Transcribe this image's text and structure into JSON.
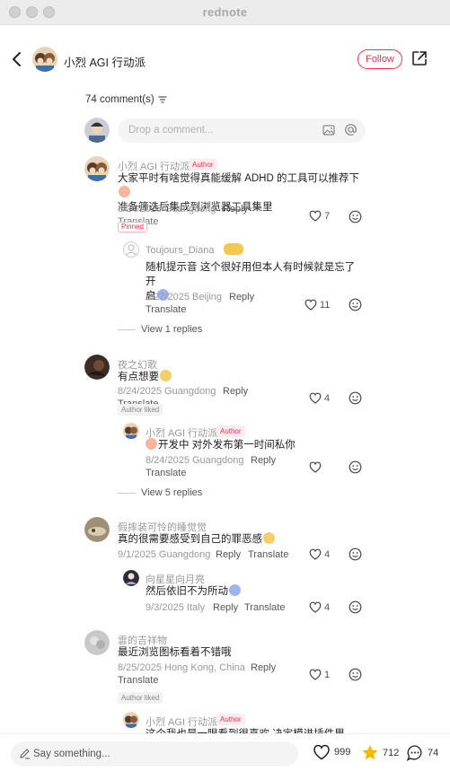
{
  "window": {
    "title": "rednote"
  },
  "header": {
    "author_name": "小烈 AGI 行动派",
    "follow_label": "Follow"
  },
  "comments_count": "74 comment(s)",
  "drop_placeholder": "Drop a comment...",
  "comments": [
    {
      "name": "小烈 AGI 行动派",
      "author_badge": "Author",
      "text_line1": "大家平时有啥觉得真能缓解 ADHD 的工具可以推荐下",
      "text_line2": "准备筛选后集成到浏览器工具集里",
      "date": "8/24/2025",
      "location": "Guangdong",
      "reply": "Reply",
      "translate": "Translate",
      "likes": "7",
      "pinned": "Pinned"
    },
    {
      "name": "Toujours_Diana",
      "text_line1": "随机提示音 这个很好用但本人有时候就是忘了开",
      "text_line2": "启",
      "date": "8/27/2025",
      "location": "Beijing",
      "reply": "Reply",
      "translate": "Translate",
      "likes": "11",
      "view_replies": "View 1 replies"
    },
    {
      "name": "夜之幻歌",
      "text_line1": "有点想要",
      "date": "8/24/2025",
      "location": "Guangdong",
      "reply": "Reply",
      "translate": "Translate",
      "likes": "4",
      "liked_badge": "Author liked"
    },
    {
      "name": "小烈 AGI 行动派",
      "author_badge": "Author",
      "text_line1": "开发中 对外发布第一时间私你",
      "date": "8/24/2025",
      "location": "Guangdong",
      "reply": "Reply",
      "translate": "Translate",
      "view_replies": "View 5 replies"
    },
    {
      "name": "假摔装可怜的睡觉觉",
      "text_line1": "真的很需要感受到自己的罪恶感",
      "date": "9/1/2025",
      "location": "Guangdong",
      "reply": "Reply",
      "translate": "Translate",
      "likes": "4"
    },
    {
      "name": "向星星向月亮",
      "text_line1": "然后依旧不为所动",
      "date": "9/3/2025",
      "location": "Italy",
      "reply": "Reply",
      "translate": "Translate",
      "likes": "4"
    },
    {
      "name": "雲的吉祥物",
      "text_line1": "最近浏览图标看着不错哦",
      "date": "8/25/2025",
      "location": "Hong Kong, China",
      "reply": "Reply",
      "translate": "Translate",
      "likes": "1",
      "liked_badge": "Author liked"
    },
    {
      "name": "小烈 AGI 行动派",
      "author_badge": "Author",
      "text_line1": "这个我也是一眼看到很喜欢 决定模进插件里"
    }
  ],
  "footer": {
    "say_placeholder": "Say something...",
    "likes": "999",
    "collects": "712",
    "comments": "74"
  },
  "colors": {
    "accent": "#ff2e4d",
    "star": "#f5b800"
  }
}
